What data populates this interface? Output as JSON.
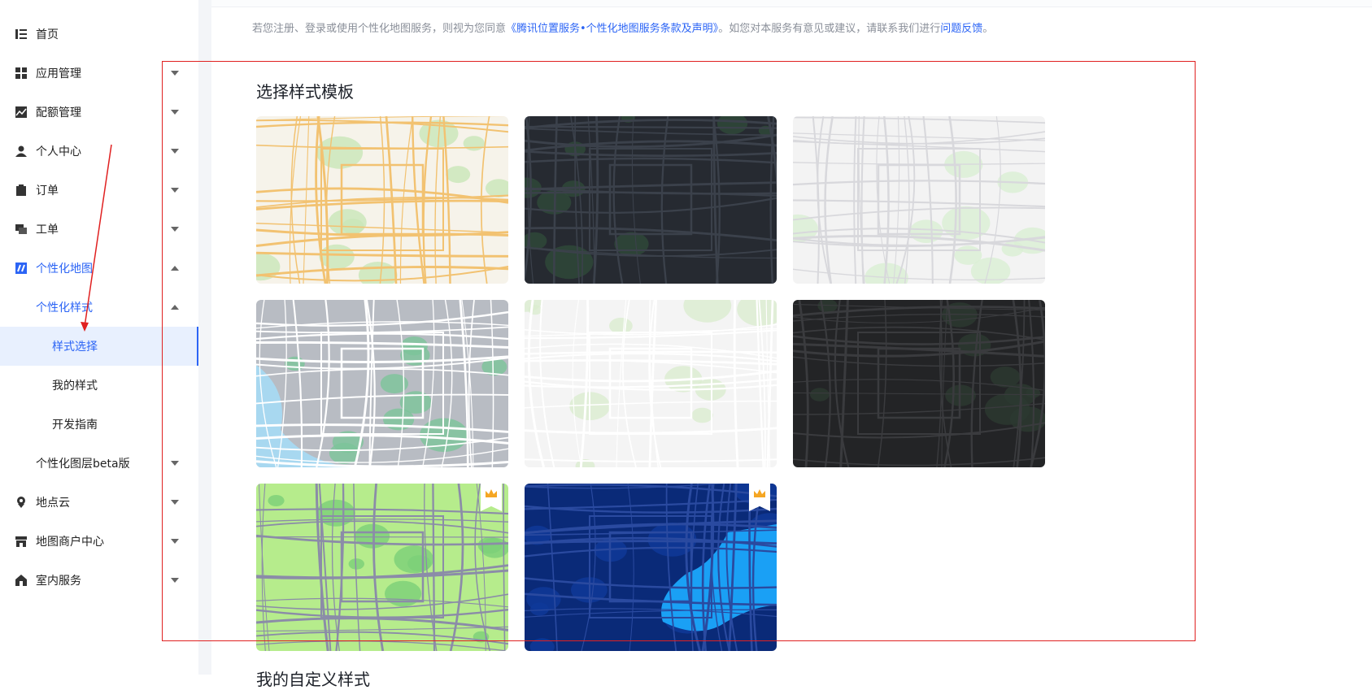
{
  "sidebar": {
    "items": [
      {
        "label": "首页",
        "icon": "home-list-icon",
        "state": "collapsed"
      },
      {
        "label": "应用管理",
        "icon": "app-grid-icon",
        "state": "collapsed"
      },
      {
        "label": "配额管理",
        "icon": "quota-chart-icon",
        "state": "collapsed"
      },
      {
        "label": "个人中心",
        "icon": "user-icon",
        "state": "collapsed"
      },
      {
        "label": "订单",
        "icon": "clipboard-icon",
        "state": "collapsed"
      },
      {
        "label": "工单",
        "icon": "ticket-chat-icon",
        "state": "collapsed"
      },
      {
        "label": "个性化地图",
        "icon": "custom-map-icon",
        "state": "expanded"
      },
      {
        "label": "个性化样式",
        "state": "expanded"
      },
      {
        "label": "样式选择",
        "state": "selected"
      },
      {
        "label": "我的样式"
      },
      {
        "label": "开发指南"
      },
      {
        "label": "个性化图层beta版",
        "state": "collapsed"
      },
      {
        "label": "地点云",
        "icon": "location-pin-icon",
        "state": "collapsed"
      },
      {
        "label": "地图商户中心",
        "icon": "store-icon",
        "state": "collapsed"
      },
      {
        "label": "室内服务",
        "icon": "building-icon",
        "state": "collapsed"
      }
    ]
  },
  "notice": {
    "prefix": "若您注册、登录或使用个性化地图服务，则视为您同意",
    "terms_link": "《腾讯位置服务•个性化地图服务条款及声明》",
    "middle": "。如您对本服务有意见或建议，请联系我们进行",
    "feedback_link": "问题反馈",
    "suffix": "。"
  },
  "main": {
    "section_title": "选择样式模板",
    "next_section_title": "我的自定义样式",
    "templates": [
      {
        "name": "standard-light",
        "bg": "#f6f3ea",
        "roads": "#f2c271",
        "green": "#c9e6b8",
        "premium": false
      },
      {
        "name": "dark",
        "bg": "#262a31",
        "roads": "#3b414b",
        "green": "#2f4a3a",
        "premium": false
      },
      {
        "name": "light-gray",
        "bg": "#f3f3f3",
        "roads": "#d8d8dc",
        "green": "#d9efd3",
        "premium": false
      },
      {
        "name": "blue-sea",
        "bg": "#b8bcc3",
        "roads": "#ffffff",
        "green": "#7cc49a",
        "premium": false
      },
      {
        "name": "white",
        "bg": "#f4f4f4",
        "roads": "#ffffff",
        "green": "#dbecd0",
        "premium": false
      },
      {
        "name": "graphite",
        "bg": "#232426",
        "roads": "#3a3b3e",
        "green": "#2c3a31",
        "premium": false
      },
      {
        "name": "fresh-green",
        "bg": "#b6ec8c",
        "roads": "#8b8ca8",
        "green": "#7ccf78",
        "premium": true
      },
      {
        "name": "deep-blue",
        "bg": "#0a2a78",
        "roads": "#2a4aa0",
        "green": "#0f3a9a",
        "premium": true
      }
    ],
    "crown_icon": "crown-icon"
  },
  "colors": {
    "accent": "#2b64f5",
    "annotation": "#e02020"
  }
}
